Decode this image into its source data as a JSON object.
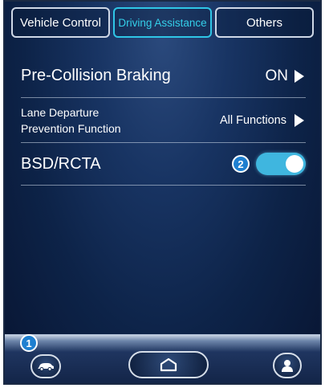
{
  "tabs": [
    {
      "label": "Vehicle Control",
      "active": false
    },
    {
      "label": "Driving Assistance",
      "active": true
    },
    {
      "label": "Others",
      "active": false
    }
  ],
  "settings": [
    {
      "label": "Pre-Collision Braking",
      "value": "ON"
    },
    {
      "label_line1": "Lane Departure",
      "label_line2": "Prevention Function",
      "value": "All Functions"
    },
    {
      "label": "BSD/RCTA",
      "toggle_on": true
    }
  ],
  "callouts": {
    "badge_1": "1",
    "badge_2": "2"
  },
  "dock": {
    "left_icon": "car-icon",
    "center_icon": "home-icon",
    "right_icon": "user-icon"
  },
  "colors": {
    "accent": "#34cfe9",
    "toggle_on": "#3fb6df",
    "badge": "#1e7fd0"
  }
}
